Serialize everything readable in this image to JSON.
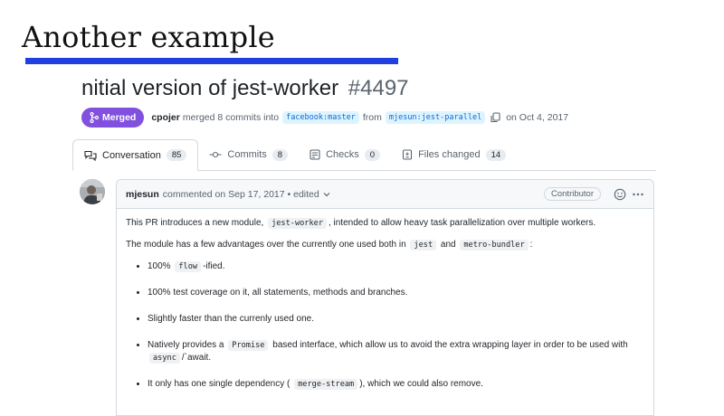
{
  "slide": {
    "title": "Another example"
  },
  "pr": {
    "title": "nitial version of jest-worker",
    "number": "#4497",
    "status": "Merged",
    "author": "cpojer",
    "merge_text": "merged 8 commits into",
    "base_branch": "facebook:master",
    "from_text": "from",
    "head_branch": "mjesun:jest-parallel",
    "date_text": "on Oct 4, 2017"
  },
  "tabs": [
    {
      "label": "Conversation",
      "count": "85",
      "icon": "conversation-icon"
    },
    {
      "label": "Commits",
      "count": "8",
      "icon": "commit-icon"
    },
    {
      "label": "Checks",
      "count": "0",
      "icon": "checks-icon"
    },
    {
      "label": "Files changed",
      "count": "14",
      "icon": "file-diff-icon"
    }
  ],
  "comment": {
    "author": "mjesun",
    "meta": "commented on Sep 17, 2017 • edited",
    "role": "Contributor",
    "p1": {
      "pre": "This PR introduces a new module,",
      "code": "jest-worker",
      "post": ", intended to allow heavy task parallelization over multiple workers."
    },
    "p2": {
      "pre": "The module has a few advantages over the currently one used both in",
      "code1": "jest",
      "mid": "and",
      "code2": "metro-bundler",
      "post": ":"
    },
    "bullets": {
      "b1": {
        "pre": "100%",
        "code": "flow",
        "post": "-ified."
      },
      "b2": {
        "text": "100% test coverage on it, all statements, methods and branches."
      },
      "b3": {
        "text": "Slightly faster than the currenly used one."
      },
      "b4": {
        "pre": "Natively provides a",
        "code": "Promise",
        "mid": "based interface, which allow us to avoid the extra wrapping layer in order to be used with",
        "code2": "async",
        "post": "/`await."
      },
      "b5": {
        "pre": "It only has one single dependency (",
        "code": "merge-stream",
        "post": "), which we could also remove."
      }
    }
  },
  "colors": {
    "merged": "#8250df",
    "underline": "#1f3fe0",
    "link": "#0969da"
  }
}
